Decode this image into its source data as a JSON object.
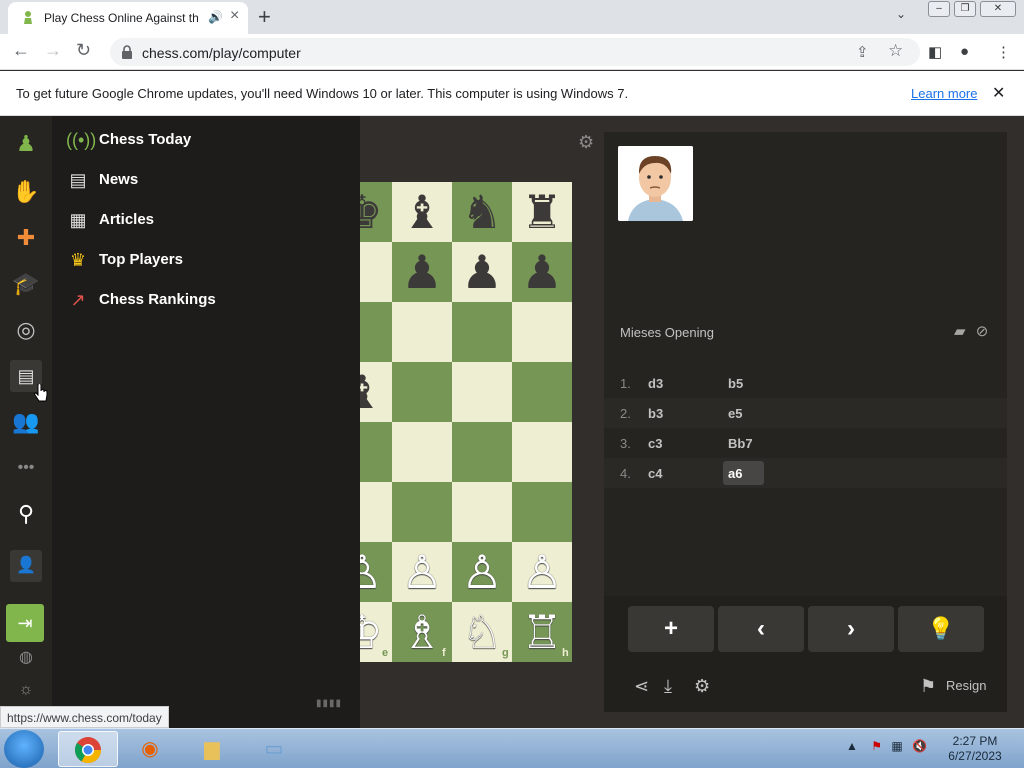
{
  "browser": {
    "tab_title": "Play Chess Online Against th",
    "url": "chess.com/play/computer",
    "infobar_message": "To get future Google Chrome updates, you'll need Windows 10 or later. This computer is using Windows 7.",
    "infobar_link": "Learn more",
    "status_url": "https://www.chess.com/today"
  },
  "flyout_menu": {
    "items": [
      {
        "label": "Chess Today",
        "icon": "broadcast-icon"
      },
      {
        "label": "News",
        "icon": "newspaper-icon"
      },
      {
        "label": "Articles",
        "icon": "article-icon"
      },
      {
        "label": "Top Players",
        "icon": "crown-icon"
      },
      {
        "label": "Chess Rankings",
        "icon": "trend-chart-icon"
      }
    ]
  },
  "board": {
    "files_visible": [
      "e",
      "f",
      "g",
      "h"
    ]
  },
  "game": {
    "opening": "Mieses Opening",
    "moves": [
      {
        "num": "1.",
        "white": "d3",
        "black": "b5"
      },
      {
        "num": "2.",
        "white": "b3",
        "black": "e5"
      },
      {
        "num": "3.",
        "white": "c3",
        "black": "Bb7"
      },
      {
        "num": "4.",
        "white": "c4",
        "black": "a6"
      }
    ],
    "resign_label": "Resign"
  },
  "taskbar": {
    "time": "2:27 PM",
    "date": "6/27/2023"
  },
  "colors": {
    "board_light": "#eeeed2",
    "board_dark": "#769656",
    "site_bg": "#312e2b",
    "accent_green": "#81b64c"
  }
}
